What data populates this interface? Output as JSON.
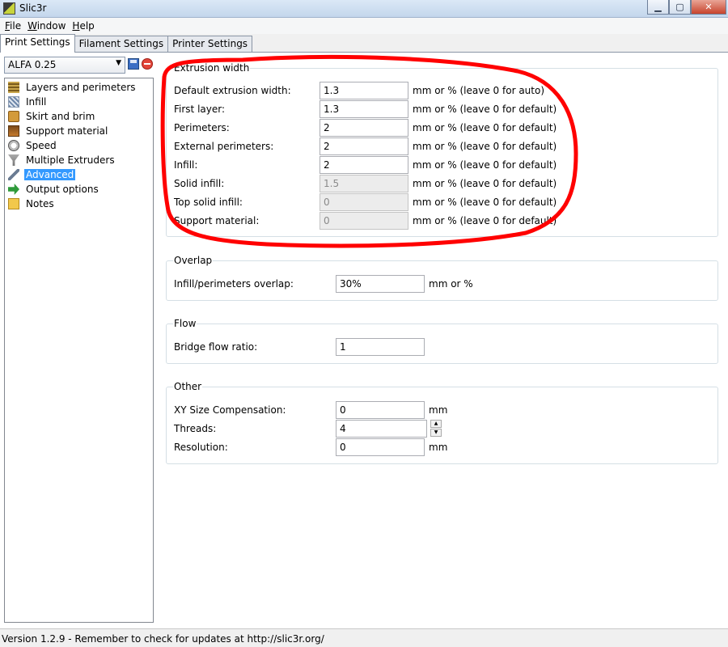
{
  "window": {
    "title": "Slic3r"
  },
  "menu": [
    {
      "u": "F",
      "rest": "ile"
    },
    {
      "u": "W",
      "rest": "indow"
    },
    {
      "u": "H",
      "rest": "elp"
    }
  ],
  "tabs": [
    "Print Settings",
    "Filament Settings",
    "Printer Settings"
  ],
  "preset": {
    "selected": "ALFA 0.25"
  },
  "sidebar": {
    "items": [
      {
        "label": "Layers and perimeters",
        "icon": "layers-icon"
      },
      {
        "label": "Infill",
        "icon": "infill-icon"
      },
      {
        "label": "Skirt and brim",
        "icon": "skirt-icon"
      },
      {
        "label": "Support material",
        "icon": "support-icon"
      },
      {
        "label": "Speed",
        "icon": "speed-icon"
      },
      {
        "label": "Multiple Extruders",
        "icon": "funnel-icon"
      },
      {
        "label": "Advanced",
        "icon": "wrench-icon"
      },
      {
        "label": "Output options",
        "icon": "output-icon"
      },
      {
        "label": "Notes",
        "icon": "notes-icon"
      }
    ],
    "selected": "Advanced"
  },
  "extrusion_width": {
    "title": "Extrusion width",
    "rows": [
      {
        "label": "Default extrusion width:",
        "value": "1.3",
        "unit": "mm or % (leave 0 for auto)"
      },
      {
        "label": "First layer:",
        "value": "1.3",
        "unit": "mm or % (leave 0 for default)"
      },
      {
        "label": "Perimeters:",
        "value": "2",
        "unit": "mm or % (leave 0 for default)"
      },
      {
        "label": "External perimeters:",
        "value": "2",
        "unit": "mm or % (leave 0 for default)"
      },
      {
        "label": "Infill:",
        "value": "2",
        "unit": "mm or % (leave 0 for default)"
      },
      {
        "label": "Solid infill:",
        "value": "1.5",
        "unit": "mm or % (leave 0 for default)"
      },
      {
        "label": "Top solid infill:",
        "value": "0",
        "unit": "mm or % (leave 0 for default)"
      },
      {
        "label": "Support material:",
        "value": "0",
        "unit": "mm or % (leave 0 for default)"
      }
    ]
  },
  "overlap": {
    "title": "Overlap",
    "label": "Infill/perimeters overlap:",
    "value": "30%",
    "unit": "mm or %"
  },
  "flow": {
    "title": "Flow",
    "label": "Bridge flow ratio:",
    "value": "1"
  },
  "other": {
    "title": "Other",
    "rows": [
      {
        "label": "XY Size Compensation:",
        "value": "0",
        "unit": "mm"
      },
      {
        "label": "Threads:",
        "value": "4",
        "unit": ""
      },
      {
        "label": "Resolution:",
        "value": "0",
        "unit": "mm"
      }
    ]
  },
  "status": {
    "text": "Version 1.2.9 - Remember to check for updates at http://slic3r.org/"
  },
  "colors": {
    "annotation": "#ff0000",
    "selection": "#3399ff"
  }
}
